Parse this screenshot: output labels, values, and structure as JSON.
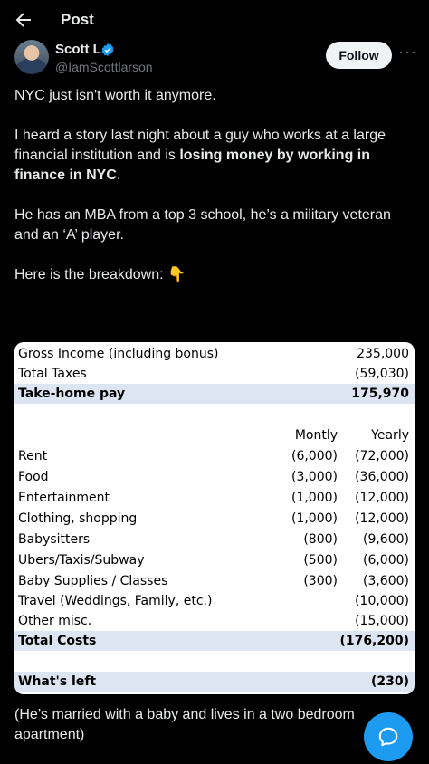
{
  "header": {
    "title": "Post"
  },
  "author": {
    "name": "Scott L",
    "handle": "@IamScottlarson",
    "follow_label": "Follow",
    "more_label": "···"
  },
  "tweet": {
    "p1": "NYC just isn't worth it anymore.",
    "p2_a": "I heard a story last night about a guy who works at a large financial institution and is ",
    "p2_b": "losing money by working in finance in NYC",
    "p2_c": ".",
    "p3": "He has an MBA from a top 3 school, he’s a military veteran and an ‘A’ player.",
    "p4": "Here is the breakdown: 👇",
    "p5": "(He’s married with a baby and lives in a two bedroom apartment)"
  },
  "sheet": {
    "gross": {
      "label": "Gross Income (including bonus)",
      "yearly": "235,000"
    },
    "taxes": {
      "label": "Total Taxes",
      "yearly": "(59,030)"
    },
    "takehome": {
      "label": "Take-home pay",
      "yearly": "175,970"
    },
    "col_monthly": "Montly",
    "col_yearly": "Yearly",
    "expenses": [
      {
        "label": "Rent",
        "monthly": "(6,000)",
        "yearly": "(72,000)"
      },
      {
        "label": "Food",
        "monthly": "(3,000)",
        "yearly": "(36,000)"
      },
      {
        "label": "Entertainment",
        "monthly": "(1,000)",
        "yearly": "(12,000)"
      },
      {
        "label": "Clothing, shopping",
        "monthly": "(1,000)",
        "yearly": "(12,000)"
      },
      {
        "label": "Babysitters",
        "monthly": "(800)",
        "yearly": "(9,600)"
      },
      {
        "label": "Ubers/Taxis/Subway",
        "monthly": "(500)",
        "yearly": "(6,000)"
      },
      {
        "label": "Baby Supplies / Classes",
        "monthly": "(300)",
        "yearly": "(3,600)"
      },
      {
        "label": "Travel (Weddings, Family, etc.)",
        "monthly": "",
        "yearly": "(10,000)"
      },
      {
        "label": "Other misc.",
        "monthly": "",
        "yearly": "(15,000)"
      }
    ],
    "total_costs": {
      "label": "Total Costs",
      "yearly": "(176,200)"
    },
    "whats_left": {
      "label": "What's left",
      "yearly": "(230)"
    }
  },
  "colors": {
    "accent": "#1d9bf0",
    "table_highlight": "#dce5f1"
  }
}
